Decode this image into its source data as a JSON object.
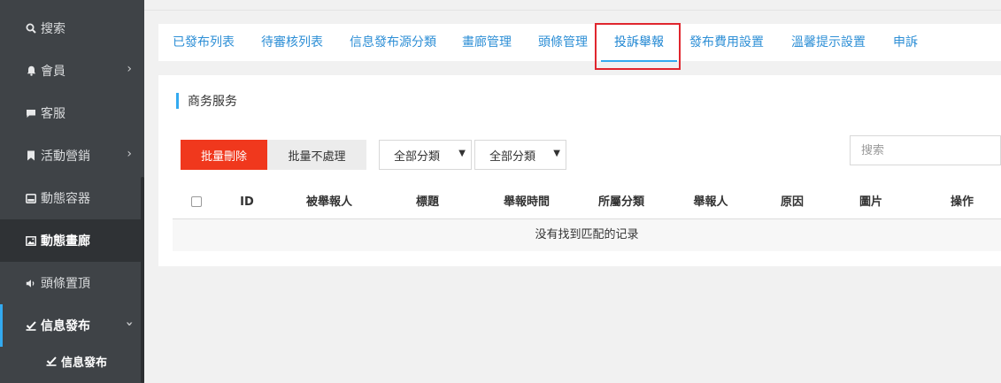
{
  "sidebar": {
    "items": [
      {
        "label": "搜索",
        "icon": "search-icon"
      },
      {
        "label": "會員",
        "icon": "bell-icon"
      },
      {
        "label": "客服",
        "icon": "chat-icon"
      },
      {
        "label": "活動營銷",
        "icon": "bookmark-icon"
      },
      {
        "label": "動態容器",
        "icon": "hdd-icon"
      },
      {
        "label": "動態畫廊",
        "icon": "picture-icon"
      },
      {
        "label": "頭條置頂",
        "icon": "volume-icon"
      },
      {
        "label": "信息發布",
        "icon": "check-square-icon"
      }
    ],
    "sub_items": [
      {
        "label": "信息發布",
        "icon": "check-square-icon"
      }
    ]
  },
  "tabs": [
    {
      "label": "已發布列表"
    },
    {
      "label": "待審核列表"
    },
    {
      "label": "信息發布源分類"
    },
    {
      "label": "畫廊管理"
    },
    {
      "label": "頭條管理"
    },
    {
      "label": "投訴舉報"
    },
    {
      "label": "發布費用設置"
    },
    {
      "label": "溫馨提示設置"
    },
    {
      "label": "申訴"
    }
  ],
  "active_tab": "投訴舉報",
  "section": {
    "title": "商务服务"
  },
  "toolbar": {
    "batch_delete": "批量刪除",
    "batch_ignore": "批量不處理",
    "category_select_1": "全部分類",
    "category_select_2": "全部分類",
    "search_placeholder": "搜索"
  },
  "table": {
    "columns": [
      "ID",
      "被舉報人",
      "標題",
      "舉報時間",
      "所屬分類",
      "舉報人",
      "原因",
      "圖片",
      "操作"
    ],
    "empty_text": "没有找到匹配的记录"
  },
  "colors": {
    "sidebar_bg": "#3f4347",
    "accent": "#33aaf0",
    "danger": "#f0381d",
    "tab_link": "#2e8fd6",
    "highlight_box": "#e0262e"
  }
}
